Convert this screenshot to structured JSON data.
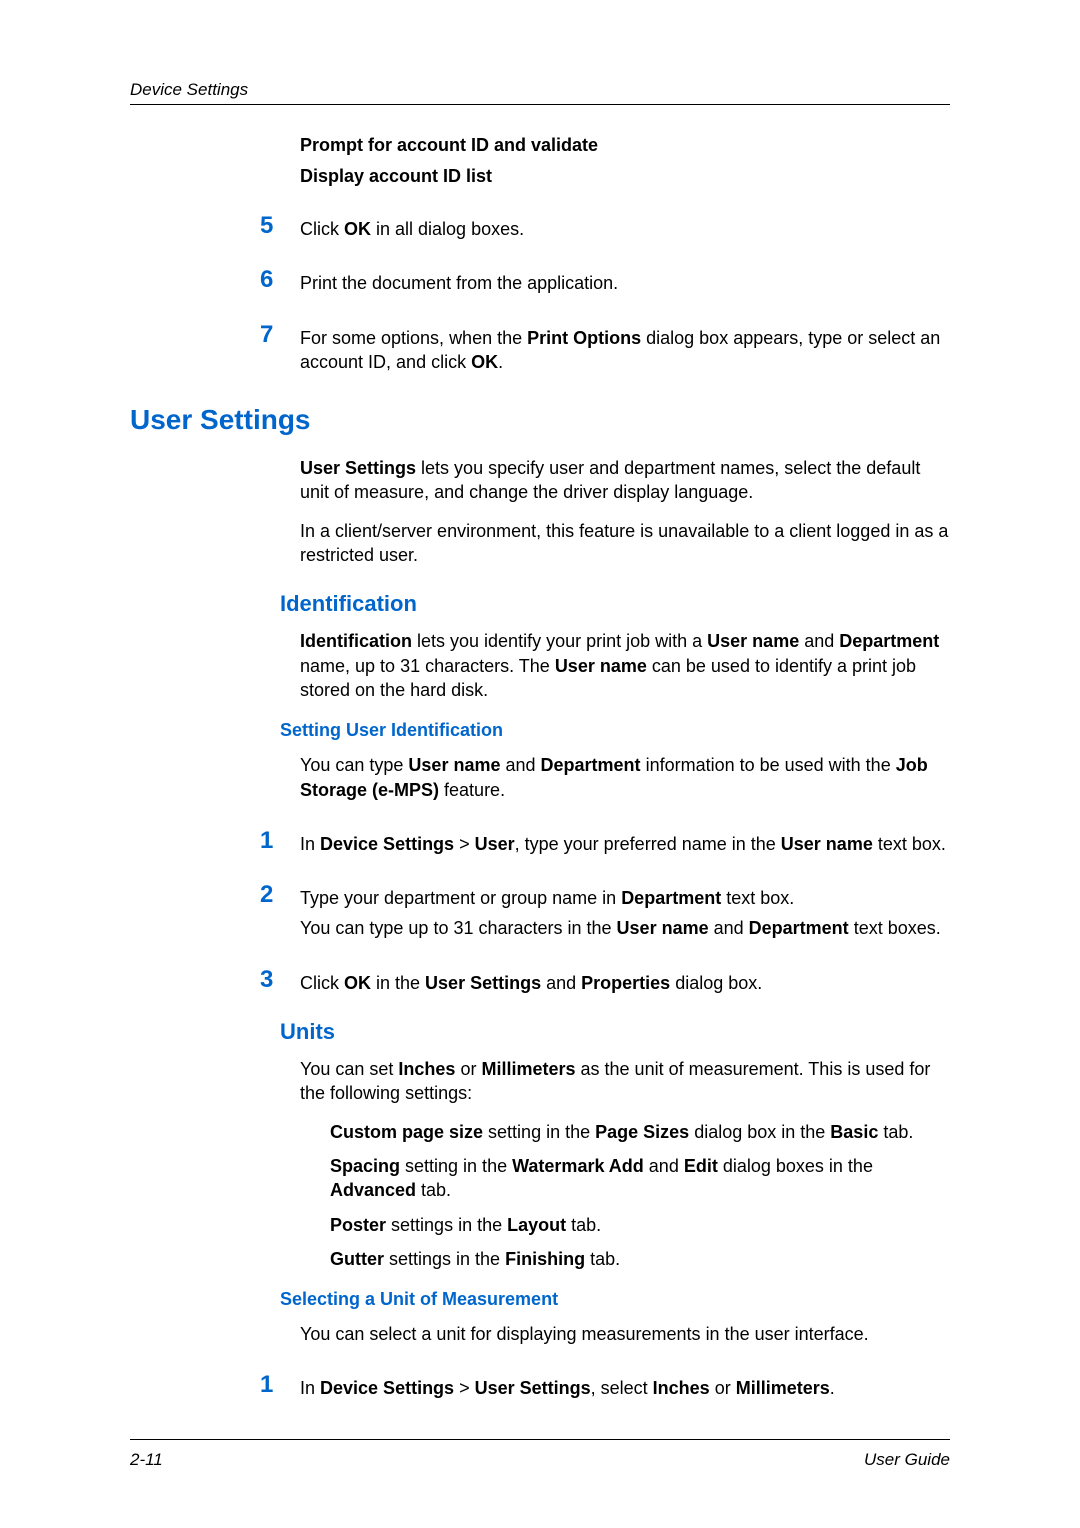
{
  "header": {
    "title": "Device Settings"
  },
  "intro": {
    "line1": "Prompt for account ID and validate",
    "line2": "Display account ID list"
  },
  "steps_top": {
    "s5": {
      "num": "5",
      "pre": "Click ",
      "b1": "OK",
      "post": " in all dialog boxes."
    },
    "s6": {
      "num": "6",
      "text": "Print the document from the application."
    },
    "s7": {
      "num": "7",
      "pre": "For some options, when the ",
      "b1": "Print Options",
      "mid": " dialog box appears, type or select an account ID, and click ",
      "b2": "OK",
      "post": "."
    }
  },
  "h1": "User Settings",
  "us_p1": {
    "b1": "User Settings",
    "post": " lets you specify user and department names, select the default unit of measure, and change the driver display language."
  },
  "us_p2": "In a client/server environment, this feature is unavailable to a client logged in as a restricted user.",
  "ident": {
    "h2": "Identification",
    "p1": {
      "b1": "Identification",
      "t1": " lets you identify your print job with a ",
      "b2": "User name",
      "t2": " and ",
      "b3": "Department",
      "t3": " name, up to 31 characters. The ",
      "b4": "User name",
      "t4": " can be used to identify a print job stored on the hard disk."
    },
    "h3": "Setting User Identification",
    "p2": {
      "t1": "You can type ",
      "b1": "User name",
      "t2": " and ",
      "b2": "Department",
      "t3": " information to be used with the ",
      "b3": "Job Storage (e-MPS)",
      "t4": " feature."
    },
    "s1": {
      "num": "1",
      "t1": "In ",
      "b1": "Device Settings",
      "t2": " > ",
      "b2": "User",
      "t3": ", type your preferred name in the ",
      "b3": "User name",
      "t4": " text box."
    },
    "s2": {
      "num": "2",
      "t1": "Type your department or group name in ",
      "b1": "Department",
      "t2": " text box."
    },
    "s2b": {
      "t1": "You can type up to 31 characters in the ",
      "b1": "User name",
      "t2": " and ",
      "b2": "Department",
      "t3": " text boxes."
    },
    "s3": {
      "num": "3",
      "t1": "Click ",
      "b1": "OK",
      "t2": " in the ",
      "b2": "User Settings",
      "t3": " and ",
      "b3": "Properties",
      "t4": " dialog box."
    }
  },
  "units": {
    "h2": "Units",
    "p1": {
      "t1": "You can set ",
      "b1": "Inches",
      "t2": " or ",
      "b2": "Millimeters",
      "t3": " as the unit of measurement. This is used for the following settings:"
    },
    "li1": {
      "b1": "Custom page size",
      "t1": " setting in the ",
      "b2": "Page Sizes",
      "t2": " dialog box in the ",
      "b3": "Basic",
      "t3": " tab."
    },
    "li2": {
      "b1": "Spacing",
      "t1": " setting in the ",
      "b2": "Watermark Add",
      "t2": " and ",
      "b3": "Edit",
      "t3": " dialog boxes in the ",
      "b4": "Advanced",
      "t4": " tab."
    },
    "li3": {
      "b1": "Poster",
      "t1": " settings in the ",
      "b2": "Layout",
      "t2": " tab."
    },
    "li4": {
      "b1": "Gutter",
      "t1": " settings in the ",
      "b2": "Finishing",
      "t2": " tab."
    },
    "h3": "Selecting a Unit of Measurement",
    "p2": "You can select a unit for displaying measurements in the user interface.",
    "s1": {
      "num": "1",
      "t1": "In ",
      "b1": "Device Settings",
      "t2": " > ",
      "b2": "User Settings",
      "t3": ", select ",
      "b3": "Inches",
      "t4": " or ",
      "b4": "Millimeters",
      "t5": "."
    }
  },
  "footer": {
    "left": "2-11",
    "right": "User Guide"
  }
}
